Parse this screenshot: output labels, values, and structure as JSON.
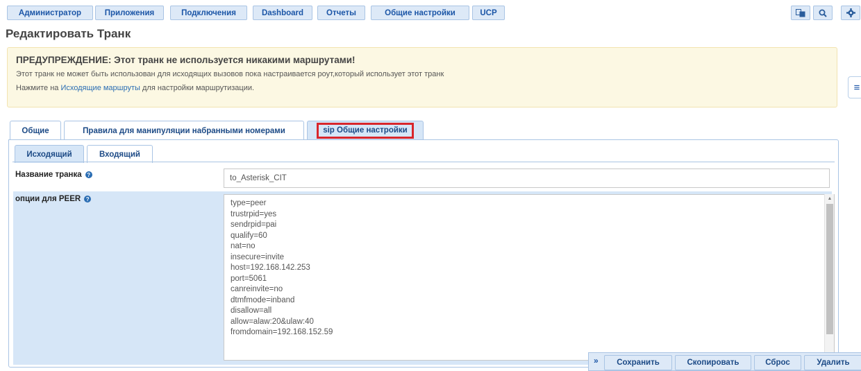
{
  "nav": {
    "items": [
      "Администратор",
      "Приложения",
      "Подключения",
      "Dashboard",
      "Отчеты",
      "Общие настройки",
      "UCP"
    ],
    "icons": [
      "translate-icon",
      "search-icon",
      "gear-icon"
    ]
  },
  "page": {
    "title": "Редактировать Транк"
  },
  "warning": {
    "title": "ПРЕДУПРЕЖДЕНИЕ: Этот транк не используется никакими маршрутами!",
    "line1": "Этот транк не может быть использован для исходящих вызовов пока настраивается роут,который использует этот транк",
    "line2_prefix": "Нажмите на ",
    "line2_link": "Исходящие маршруты",
    "line2_suffix": " для настройки маршрутизации."
  },
  "tabs": [
    {
      "label": "Общие"
    },
    {
      "label": "Правила для манипуляции набранными номерами"
    },
    {
      "label": "sip Общие настройки"
    }
  ],
  "subtabs": [
    {
      "label": "Исходящий"
    },
    {
      "label": "Входящий"
    }
  ],
  "form": {
    "trunk_name_label": "Название транка",
    "trunk_name_value": "to_Asterisk_CIT",
    "peer_options_label": "опции для PEER",
    "peer_options_lines": [
      "type=peer",
      "trustrpid=yes",
      "sendrpid=pai",
      "qualify=60",
      "nat=no",
      "insecure=invite",
      "host=192.168.142.253",
      "port=5061",
      "canreinvite=no",
      "dtmfmode=inband",
      "disallow=all",
      "allow=alaw:20&ulaw:40",
      "fromdomain=192.168.152.59"
    ]
  },
  "actions": {
    "collapse": "»",
    "save": "Сохранить",
    "copy": "Скопировать",
    "reset": "Сброс",
    "delete": "Удалить"
  },
  "colors": {
    "accent": "#1c56a7",
    "nav_bg": "#dde9f7",
    "warning_bg": "#fcf8e3",
    "highlight_border": "#d9262b"
  }
}
